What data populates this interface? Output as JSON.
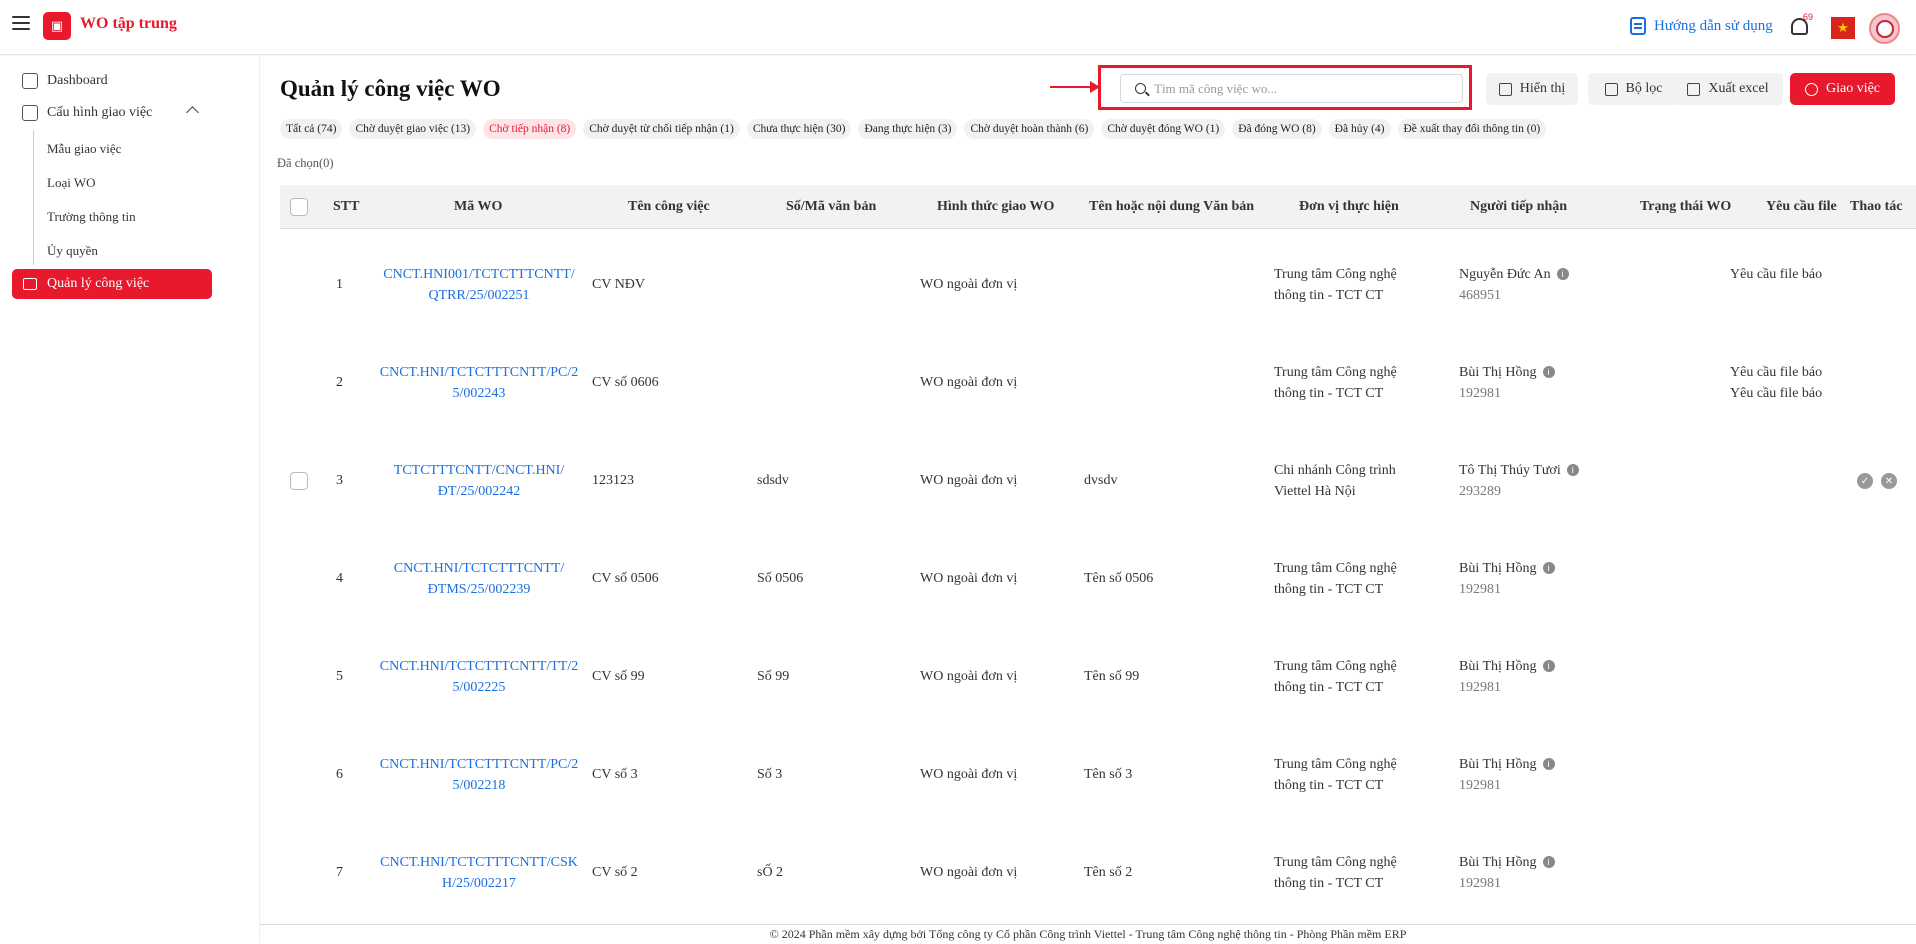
{
  "header": {
    "app_title": "WO tập trung",
    "guide_label": "Hướng dẫn sử dụng",
    "notification_count": "69"
  },
  "sidebar": {
    "dashboard": "Dashboard",
    "config": "Cấu hình giao việc",
    "sub_items": [
      "Mẫu giao việc",
      "Loại WO",
      "Trường thông tin",
      "Ủy quyền"
    ],
    "active": "Quản lý công việc"
  },
  "main": {
    "title": "Quản lý công việc WO",
    "search_placeholder": "Tìm mã công việc wo...",
    "buttons": {
      "display": "Hiển thị",
      "filter": "Bộ lọc",
      "export": "Xuất excel",
      "assign": "Giao việc"
    },
    "tabs": [
      "Tất cả (74)",
      "Chờ duyệt giao việc (13)",
      "Chờ tiếp nhận (8)",
      "Chờ duyệt từ chối tiếp nhận (1)",
      "Chưa thực hiện (30)",
      "Đang thực hiện (3)",
      "Chờ duyệt hoàn thành (6)",
      "Chờ duyệt đóng WO (1)",
      "Đã đóng WO (8)",
      "Đã hủy (4)",
      "Đề xuất thay đổi thông tin (0)"
    ],
    "active_tab_index": 2,
    "selected_count": "Đã chọn(0)"
  },
  "table": {
    "headers": [
      "STT",
      "Mã WO",
      "Tên công việc",
      "Số/Mã văn bản",
      "Hình thức giao WO",
      "Tên hoặc nội dung Văn bản",
      "Đơn vị thực hiện",
      "Người tiếp nhận",
      "Trạng thái WO",
      "Yêu cầu file",
      "Thao tác"
    ],
    "rows": [
      {
        "stt": "1",
        "code1": "CNCT.HNI001/TCTCTTTCNTT/",
        "code2": "QTRR/25/002251",
        "name": "CV NĐV",
        "doc_no": "",
        "form": "WO ngoài đơn vị",
        "doc_name": "",
        "unit1": "Trung tâm Công nghệ",
        "unit2": "thông tin - TCT CT",
        "person": "Nguyễn Đức An",
        "person_id": "468951",
        "req1": "Yêu cầu file báo",
        "req2": ""
      },
      {
        "stt": "2",
        "code1": "CNCT.HNI/TCTCTTTCNTT/PC/2",
        "code2": "5/002243",
        "name": "CV số 0606",
        "doc_no": "",
        "form": "WO ngoài đơn vị",
        "doc_name": "",
        "unit1": "Trung tâm Công nghệ",
        "unit2": "thông tin - TCT CT",
        "person": "Bùi Thị Hồng",
        "person_id": "192981",
        "req1": "Yêu cầu file báo",
        "req2": "Yêu cầu file báo"
      },
      {
        "stt": "3",
        "code1": "TCTCTTTCNTT/CNCT.HNI/",
        "code2": "ĐT/25/002242",
        "name": "123123",
        "doc_no": "sdsdv",
        "form": "WO ngoài đơn vị",
        "doc_name": "dvsdv",
        "unit1": "Chi nhánh Công trình",
        "unit2": "Viettel Hà Nội",
        "person": "Tô Thị Thúy Tươi",
        "person_id": "293289",
        "req1": "",
        "req2": ""
      },
      {
        "stt": "4",
        "code1": "CNCT.HNI/TCTCTTTCNTT/",
        "code2": "ĐTMS/25/002239",
        "name": "CV số 0506",
        "doc_no": "Số 0506",
        "form": "WO ngoài đơn vị",
        "doc_name": "Tên số 0506",
        "unit1": "Trung tâm Công nghệ",
        "unit2": "thông tin - TCT CT",
        "person": "Bùi Thị Hồng",
        "person_id": "192981",
        "req1": "",
        "req2": ""
      },
      {
        "stt": "5",
        "code1": "CNCT.HNI/TCTCTTTCNTT/TT/2",
        "code2": "5/002225",
        "name": "CV số 99",
        "doc_no": "Số 99",
        "form": "WO ngoài đơn vị",
        "doc_name": "Tên số 99",
        "unit1": "Trung tâm Công nghệ",
        "unit2": "thông tin - TCT CT",
        "person": "Bùi Thị Hồng",
        "person_id": "192981",
        "req1": "",
        "req2": ""
      },
      {
        "stt": "6",
        "code1": "CNCT.HNI/TCTCTTTCNTT/PC/2",
        "code2": "5/002218",
        "name": "CV số 3",
        "doc_no": "Số 3",
        "form": "WO ngoài đơn vị",
        "doc_name": "Tên số 3",
        "unit1": "Trung tâm Công nghệ",
        "unit2": "thông tin - TCT CT",
        "person": "Bùi Thị Hồng",
        "person_id": "192981",
        "req1": "",
        "req2": ""
      },
      {
        "stt": "7",
        "code1": "CNCT.HNI/TCTCTTTCNTT/CSK",
        "code2": "H/25/002217",
        "name": "CV số 2",
        "doc_no": "sỐ 2",
        "form": "WO ngoài đơn vị",
        "doc_name": "Tên số 2",
        "unit1": "Trung tâm Công nghệ",
        "unit2": "thông tin - TCT CT",
        "person": "Bùi Thị Hồng",
        "person_id": "192981",
        "req1": "",
        "req2": ""
      }
    ]
  },
  "footer": "© 2024 Phần mềm xây dựng bởi Tổng công ty Cổ phần Công trình Viettel - Trung tâm Công nghệ thông tin - Phòng Phần mềm ERP",
  "colors": {
    "brand": "#e8192c",
    "link": "#1a6fe0"
  }
}
